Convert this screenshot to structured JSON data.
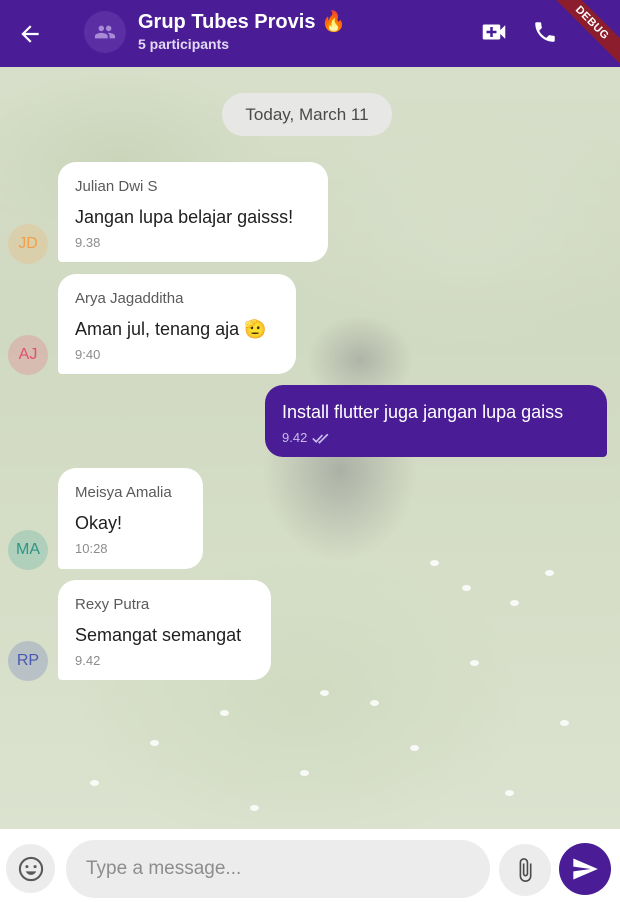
{
  "header": {
    "title": "Grup Tubes Provis 🔥",
    "subtitle": "5 participants",
    "debug_label": "DEBUG",
    "icons": {
      "back": "arrow-back-icon",
      "group": "group-icon",
      "video": "video-call-icon",
      "call": "phone-icon"
    }
  },
  "date_chip": "Today, March 11",
  "messages": [
    {
      "sender": "Julian Dwi S",
      "initials": "JD",
      "text": "Jangan lupa belajar gaisss!",
      "time": "9.38",
      "avatar_color": "#f2b46b"
    },
    {
      "sender": "Arya Jagadditha",
      "initials": "AJ",
      "text": "Aman jul, tenang aja 🫡",
      "time": "9:40",
      "avatar_color": "#e8627f"
    },
    {
      "sender": "Meisya Amalia",
      "initials": "MA",
      "text": "Okay!",
      "time": "10:28",
      "avatar_color": "#3fa79a"
    },
    {
      "sender": "Rexy Putra",
      "initials": "RP",
      "text": "Semangat semangat",
      "time": "9.42",
      "avatar_color": "#5866b8"
    }
  ],
  "outgoing": {
    "text": "Install flutter juga jangan lupa gaiss",
    "time": "9.42",
    "status_icon": "double-check-icon"
  },
  "composer": {
    "placeholder": "Type a message...",
    "icons": {
      "emoji": "emoji-icon",
      "attach": "paperclip-icon",
      "send": "send-icon"
    }
  },
  "colors": {
    "primary": "#4a1d96",
    "bubble_in": "#ffffff",
    "input_bg": "#ececec"
  }
}
